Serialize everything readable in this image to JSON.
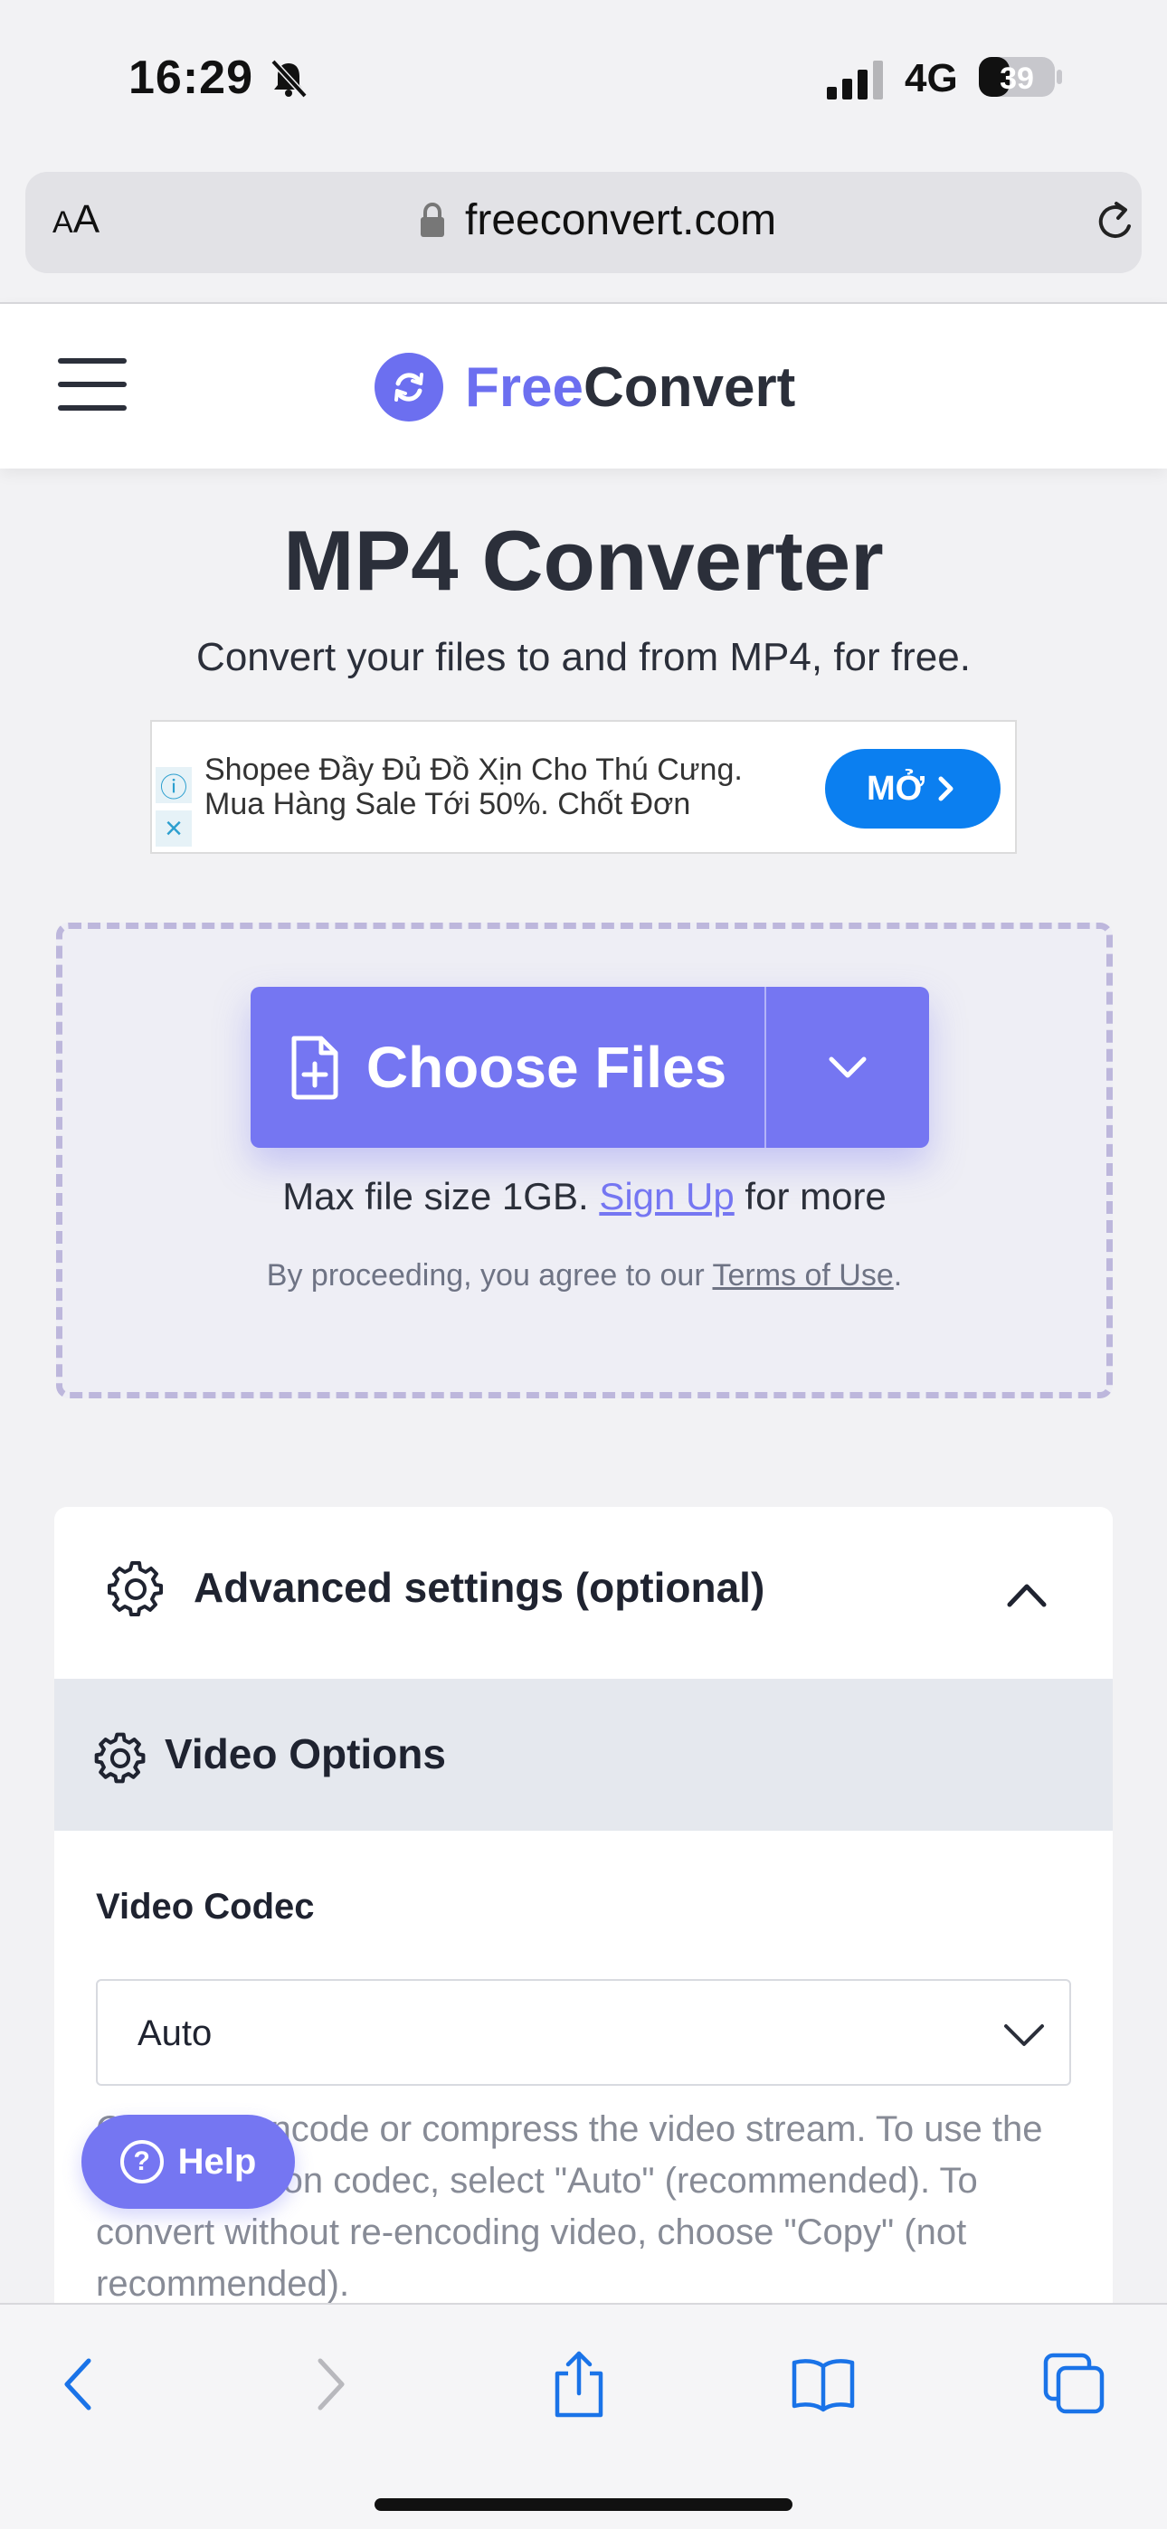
{
  "status_bar": {
    "time": "16:29",
    "network": "4G",
    "battery": "39"
  },
  "address_bar": {
    "text_size_label": "AA",
    "url": "freeconvert.com"
  },
  "header": {
    "logo_free": "Free",
    "logo_convert": "Convert"
  },
  "main": {
    "title": "MP4 Converter",
    "subtitle": "Convert your files to and from MP4, for free."
  },
  "ad": {
    "line1": "Shopee Đầy Đủ Đồ Xịn Cho Thú Cưng.",
    "line2": "Mua Hàng Sale Tới 50%. Chốt Đơn",
    "button": "MỞ"
  },
  "upload": {
    "choose_label": "Choose Files",
    "max_size_prefix": "Max file size 1GB.",
    "signup_link": "Sign Up",
    "max_size_suffix": "for more",
    "agree_prefix": "By proceeding, you agree to our",
    "terms_link": "Terms of Use",
    "agree_suffix": "."
  },
  "advanced": {
    "title": "Advanced settings (optional)",
    "section_title": "Video Options",
    "codec_label": "Video Codec",
    "codec_value": "Auto",
    "codec_description": "Codec to encode or compress the video stream. To use the most common codec, select \"Auto\" (recommended). To convert without re-encoding video, choose \"Copy\" (not recommended)."
  },
  "help": {
    "label": "Help"
  },
  "colors": {
    "brand": "#7576f2",
    "dark": "#2b2f3a",
    "ad_button": "#0b7ff0"
  }
}
